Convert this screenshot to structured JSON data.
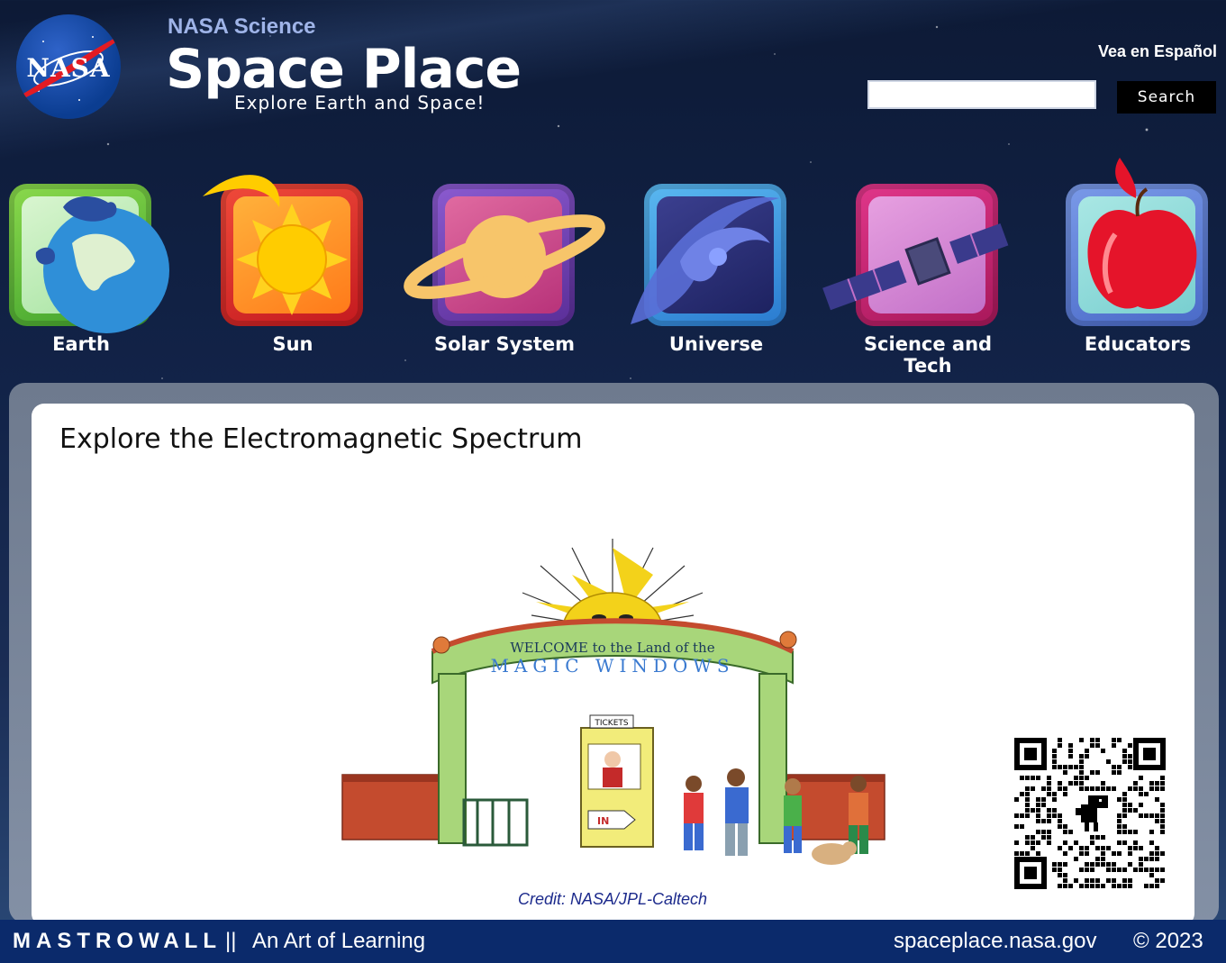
{
  "header": {
    "nasa_logo_text": "NASA",
    "brand_small": "NASA Science",
    "brand_title": "Space Place",
    "brand_tagline": "Explore Earth and Space!",
    "language_link": "Vea en Español",
    "search": {
      "placeholder": "",
      "value": "",
      "button_label": "Search"
    }
  },
  "nav": {
    "items": [
      {
        "label": "Earth",
        "icon": "earth-icon",
        "color": "#5bbf3a"
      },
      {
        "label": "Sun",
        "icon": "sun-icon",
        "color": "#e5262a"
      },
      {
        "label": "Solar System",
        "icon": "saturn-icon",
        "color": "#6a3aa8"
      },
      {
        "label": "Universe",
        "icon": "galaxy-icon",
        "color": "#3c8fd6"
      },
      {
        "label": "Science and Tech",
        "icon": "satellite-icon",
        "color": "#c2266b"
      },
      {
        "label": "Educators",
        "icon": "apple-icon",
        "color": "#5a7fd6"
      }
    ]
  },
  "main": {
    "title": "Explore the Electromagnetic Spectrum",
    "illustration": {
      "banner_top": "WELCOME to the Land of the",
      "banner_bottom": "MAGIC WINDOWS",
      "booth_sign": "TICKETS",
      "booth_pointer": "IN"
    },
    "credit": "Credit: NASA/JPL-Caltech"
  },
  "footer": {
    "brand": "MASTROWALL",
    "separator": "||",
    "tagline": "An Art of Learning",
    "site": "spaceplace.nasa.gov",
    "copyright": "© 2023"
  }
}
